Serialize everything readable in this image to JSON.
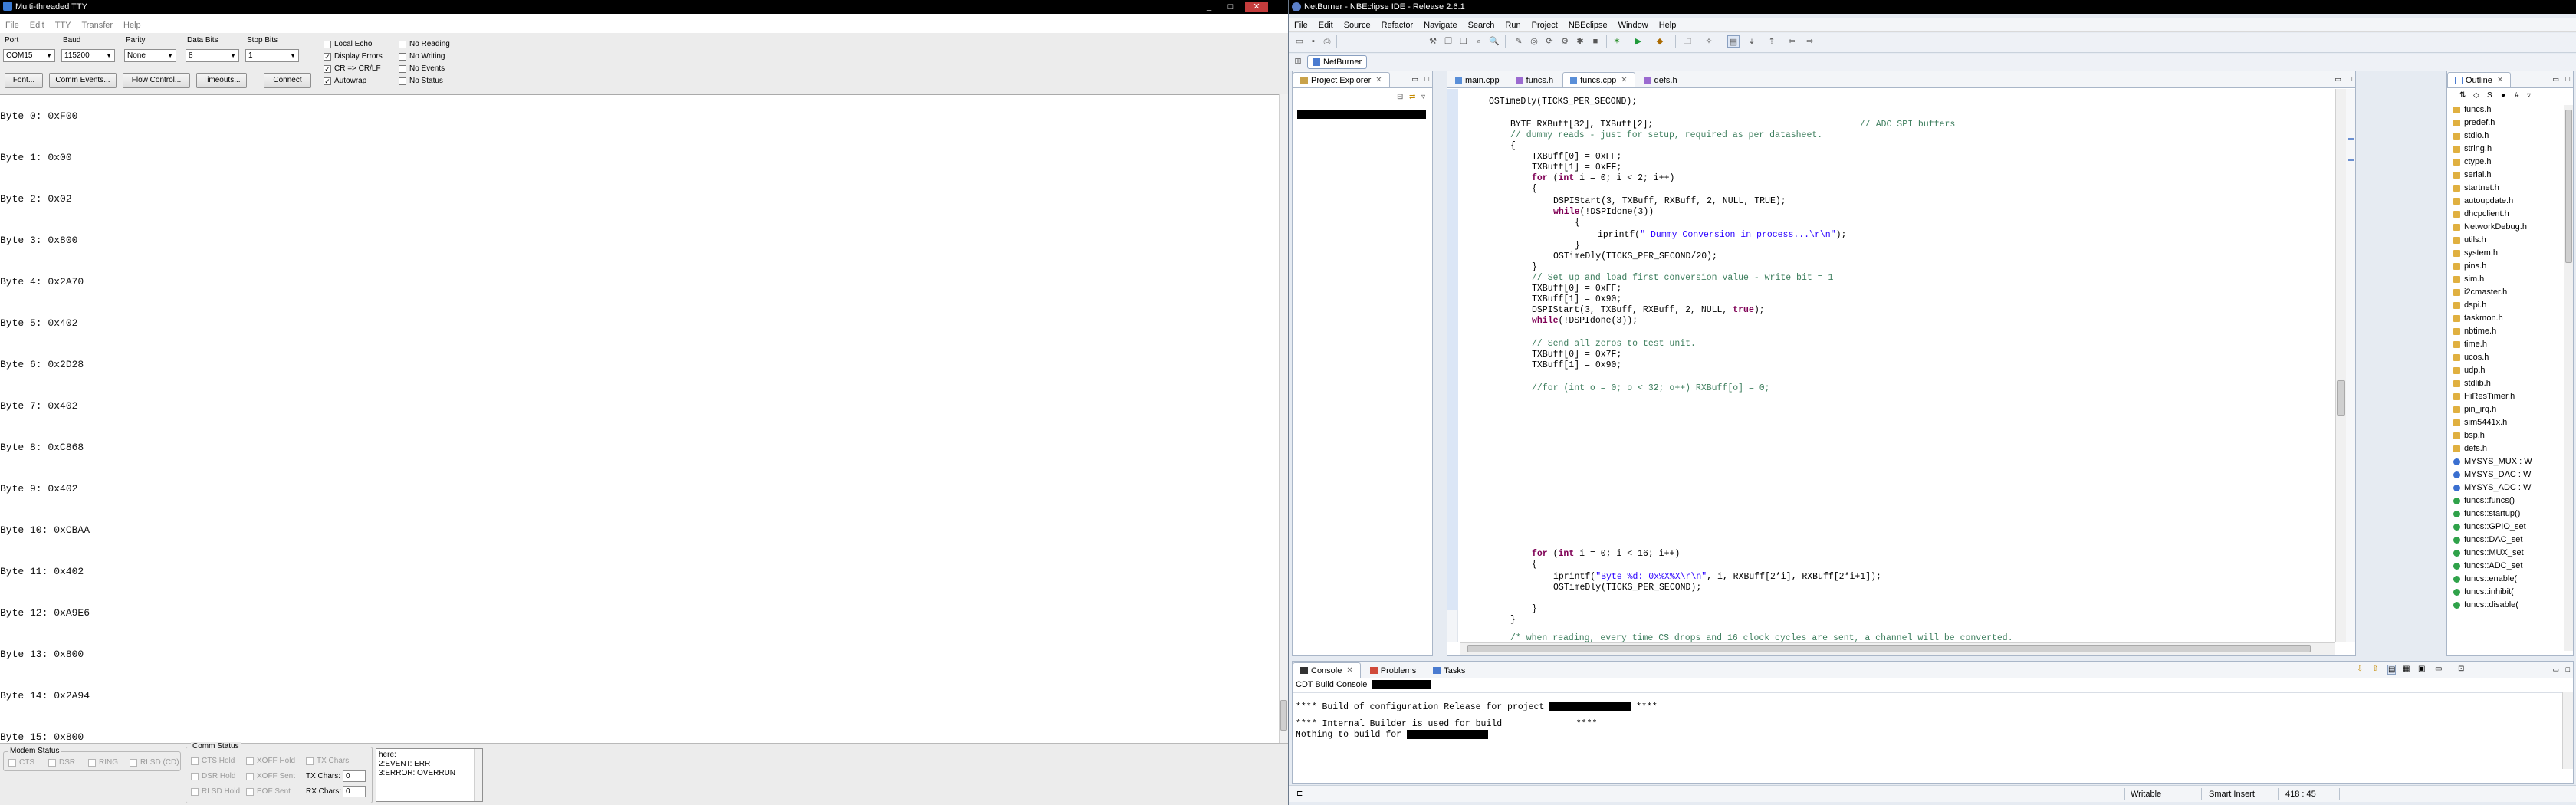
{
  "left_window": {
    "title": "Multi-threaded TTY",
    "controls": {
      "minimize": "_",
      "maximize": "□",
      "close": "✕"
    },
    "menu": [
      "File",
      "Edit",
      "TTY",
      "Transfer",
      "Help"
    ],
    "settings": {
      "port_label": "Port",
      "port_value": "COM15",
      "baud_label": "Baud",
      "baud_value": "115200",
      "parity_label": "Parity",
      "parity_value": "None",
      "databits_label": "Data Bits",
      "databits_value": "8",
      "stopbits_label": "Stop Bits",
      "stopbits_value": "1"
    },
    "checkboxes": [
      {
        "label": "Local Echo",
        "checked": false
      },
      {
        "label": "Display Errors",
        "checked": true
      },
      {
        "label": "CR => CR/LF",
        "checked": true
      },
      {
        "label": "Autowrap",
        "checked": true
      },
      {
        "label": "No Reading",
        "checked": false
      },
      {
        "label": "No Writing",
        "checked": false
      },
      {
        "label": "No Events",
        "checked": false
      },
      {
        "label": "No Status",
        "checked": false
      }
    ],
    "buttons": {
      "font": "Font...",
      "comm_events": "Comm Events...",
      "flow_control": "Flow Control...",
      "timeouts": "Timeouts...",
      "connect": "Connect"
    },
    "output_lines": [
      "Byte 0: 0xF00",
      "Byte 1: 0x00",
      "Byte 2: 0x02",
      "Byte 3: 0x800",
      "Byte 4: 0x2A70",
      "Byte 5: 0x402",
      "Byte 6: 0x2D28",
      "Byte 7: 0x402",
      "Byte 8: 0xC868",
      "Byte 9: 0x402",
      "Byte 10: 0xCBAA",
      "Byte 11: 0x402",
      "Byte 12: 0xA9E6",
      "Byte 13: 0x800",
      "Byte 14: 0x2A94",
      "Byte 15: 0x800"
    ],
    "modem_status": {
      "title": "Modem Status",
      "items": [
        "CTS",
        "DSR",
        "RING",
        "RLSD (CD)"
      ]
    },
    "comm_status": {
      "title": "Comm Status",
      "items": [
        "CTS Hold",
        "XOFF Hold",
        "TX Chars",
        "DSR Hold",
        "XOFF Sent",
        "RLSD Hold",
        "EOF Sent"
      ],
      "tx_label": "TX Chars:",
      "tx_value": "0",
      "rx_label": "RX Chars:",
      "rx_value": "0"
    },
    "event_log": [
      "here:",
      "2:EVENT: ERR",
      "3:ERROR: OVERRUN"
    ]
  },
  "right_window": {
    "title": "NetBurner - NBEclipse IDE - Release 2.6.1",
    "menu": [
      "File",
      "Edit",
      "Source",
      "Refactor",
      "Navigate",
      "Search",
      "Run",
      "Project",
      "NBEclipse",
      "Window",
      "Help"
    ],
    "perspective": "NetBurner",
    "project_explorer": {
      "title": "Project Explorer"
    },
    "editor_tabs": [
      {
        "label": "main.cpp",
        "active": false
      },
      {
        "label": "funcs.h",
        "active": false
      },
      {
        "label": "funcs.cpp",
        "active": true
      },
      {
        "label": "defs.h",
        "active": false
      }
    ],
    "code": {
      "l1": "OSTimeDly(TICKS_PER_SECOND);",
      "l2a": "BYTE RXBuff[32], TXBuff[2];",
      "l2b": "// ADC SPI buffers",
      "l3": "// dummy reads - just for setup, required as per datasheet.",
      "l4": "{",
      "l5": "TXBuff[0] = 0xFF;",
      "l6": "TXBuff[1] = 0xFF;",
      "l7a": "for",
      "l7b": " (",
      "l7c": "int",
      "l7d": " i = 0; i < 2; i++)",
      "l8": "{",
      "l9": "DSPIStart(3, TXBuff, RXBuff, 2, NULL, TRUE);",
      "l10a": "while",
      "l10b": "(!DSPIdone(3))",
      "l11": "{",
      "l12a": "iprintf(",
      "l12b": "\" Dummy Conversion in process...\\r\\n\"",
      "l12c": ");",
      "l13": "}",
      "l14": "OSTimeDly(TICKS_PER_SECOND/20);",
      "l15": "}",
      "l16": "// Set up and load first conversion value - write bit = 1",
      "l17": "TXBuff[0] = 0xFF;",
      "l18": "TXBuff[1] = 0x90;",
      "l19a": "DSPIStart(3, TXBuff, RXBuff, 2, NULL, ",
      "l19b": "true",
      "l19c": ");",
      "l20a": "while",
      "l20b": "(!DSPIdone(3));",
      "l21": "// Send all zeros to test unit.",
      "l22": "TXBuff[0] = 0x7F;",
      "l23": "TXBuff[1] = 0x90;",
      "l24": "//for (int o = 0; o < 32; o++) RXBuff[o] = 0;",
      "l25a": "for",
      "l25b": " (",
      "l25c": "int",
      "l25d": " i = 0; i < 16; i++)",
      "l26": "{",
      "l27a": "iprintf(",
      "l27b": "\"Byte %d: 0x%X%X\\r\\n\"",
      "l27c": ", i, RXBuff[2*i], RXBuff[2*i+1]);",
      "l28": "OSTimeDly(TICKS_PER_SECOND);",
      "l29": "}",
      "l30": "}",
      "l31": "/* when reading, every time CS drops and 16 clock cycles are sent, a channel will be converted."
    },
    "outline": {
      "title": "Outline",
      "items": [
        {
          "label": "funcs.h",
          "kind": "include"
        },
        {
          "label": "predef.h",
          "kind": "include"
        },
        {
          "label": "stdio.h",
          "kind": "include"
        },
        {
          "label": "string.h",
          "kind": "include"
        },
        {
          "label": "ctype.h",
          "kind": "include"
        },
        {
          "label": "serial.h",
          "kind": "include"
        },
        {
          "label": "startnet.h",
          "kind": "include"
        },
        {
          "label": "autoupdate.h",
          "kind": "include"
        },
        {
          "label": "dhcpclient.h",
          "kind": "include"
        },
        {
          "label": "NetworkDebug.h",
          "kind": "include"
        },
        {
          "label": "utils.h",
          "kind": "include"
        },
        {
          "label": "system.h",
          "kind": "include"
        },
        {
          "label": "pins.h",
          "kind": "include"
        },
        {
          "label": "sim.h",
          "kind": "include"
        },
        {
          "label": "i2cmaster.h",
          "kind": "include"
        },
        {
          "label": "dspi.h",
          "kind": "include"
        },
        {
          "label": "taskmon.h",
          "kind": "include"
        },
        {
          "label": "nbtime.h",
          "kind": "include"
        },
        {
          "label": "time.h",
          "kind": "include"
        },
        {
          "label": "ucos.h",
          "kind": "include"
        },
        {
          "label": "udp.h",
          "kind": "include"
        },
        {
          "label": "stdlib.h",
          "kind": "include"
        },
        {
          "label": "HiResTimer.h",
          "kind": "include"
        },
        {
          "label": "pin_irq.h",
          "kind": "include"
        },
        {
          "label": "sim5441x.h",
          "kind": "include"
        },
        {
          "label": "bsp.h",
          "kind": "include"
        },
        {
          "label": "defs.h",
          "kind": "include"
        },
        {
          "label": "MYSYS_MUX : W",
          "kind": "var"
        },
        {
          "label": "MYSYS_DAC : W",
          "kind": "var"
        },
        {
          "label": "MYSYS_ADC : W",
          "kind": "var"
        },
        {
          "label": "funcs::funcs()",
          "kind": "method"
        },
        {
          "label": "funcs::startup()",
          "kind": "method"
        },
        {
          "label": "funcs::GPIO_set",
          "kind": "method"
        },
        {
          "label": "funcs::DAC_set",
          "kind": "method"
        },
        {
          "label": "funcs::MUX_set",
          "kind": "method"
        },
        {
          "label": "funcs::ADC_set",
          "kind": "method"
        },
        {
          "label": "funcs::enable(",
          "kind": "method"
        },
        {
          "label": "funcs::inhibit(",
          "kind": "method"
        },
        {
          "label": "funcs::disable(",
          "kind": "method"
        }
      ]
    },
    "bottom_tabs": [
      {
        "label": "Console",
        "active": true
      },
      {
        "label": "Problems",
        "active": false
      },
      {
        "label": "Tasks",
        "active": false
      }
    ],
    "console": {
      "header": "CDT Build Console",
      "line1a": "**** Build of configuration Release for project",
      "line1b": "****",
      "line2a": "**** Internal Builder is used for build",
      "line2b": "****",
      "line3": "Nothing to build for"
    },
    "status": {
      "writable": "Writable",
      "insert": "Smart Insert",
      "position": "418 : 45"
    },
    "colors": {
      "keyword": "#7f0055",
      "comment": "#3f7f5f",
      "string": "#2a00ff",
      "accent": "#a9b6c8"
    }
  }
}
